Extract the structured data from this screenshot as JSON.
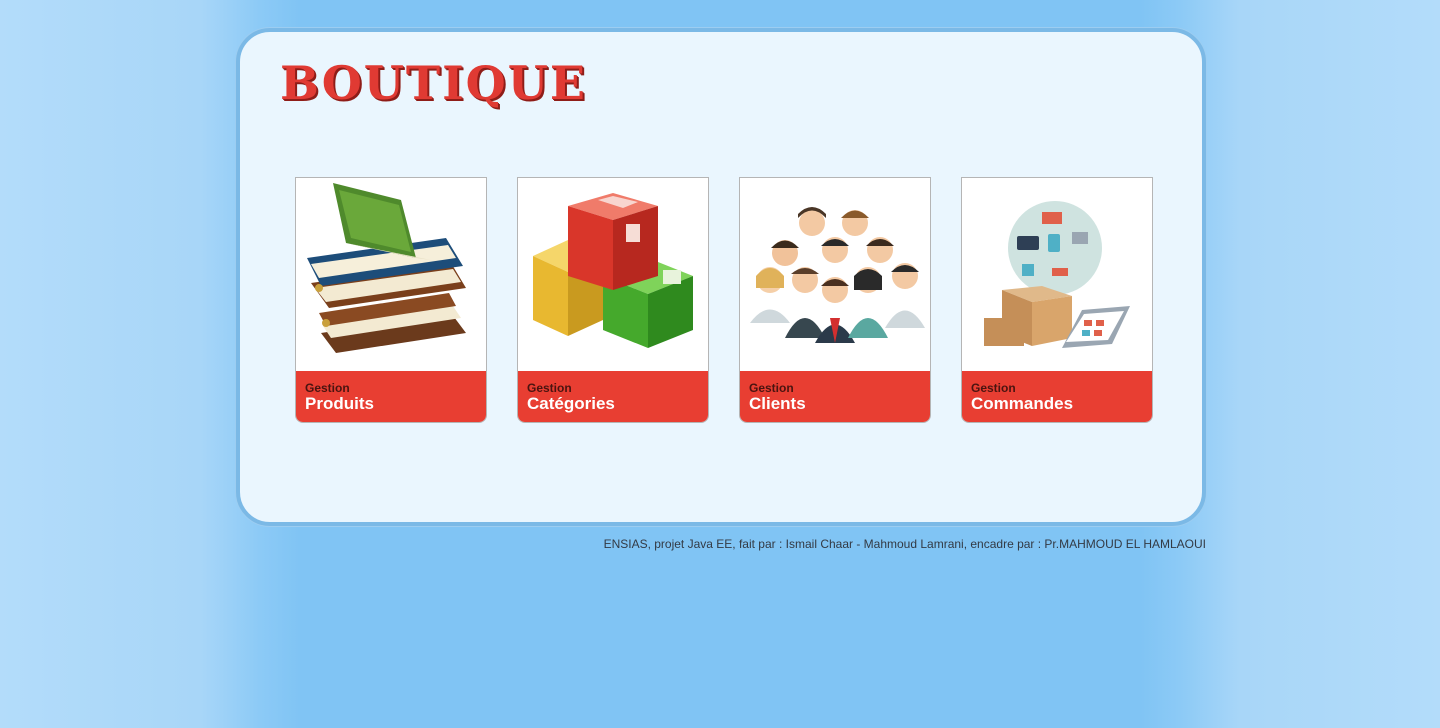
{
  "app": {
    "logo_text": "BOUTIQUE"
  },
  "tiles": [
    {
      "small": "Gestion",
      "big": "Produits",
      "icon": "books-icon"
    },
    {
      "small": "Gestion",
      "big": "Catégories",
      "icon": "boxes-icon"
    },
    {
      "small": "Gestion",
      "big": "Clients",
      "icon": "people-icon"
    },
    {
      "small": "Gestion",
      "big": "Commandes",
      "icon": "orders-icon"
    }
  ],
  "footer": {
    "text": "ENSIAS, projet Java EE, fait par : Ismail Chaar - Mahmoud Lamrani, encadre par : Pr.MAHMOUD EL HAMLAOUI"
  },
  "colors": {
    "accent": "#e83e32",
    "panel": "#eaf6fe",
    "border": "#7bb9e6",
    "background": "#80c4f4"
  }
}
